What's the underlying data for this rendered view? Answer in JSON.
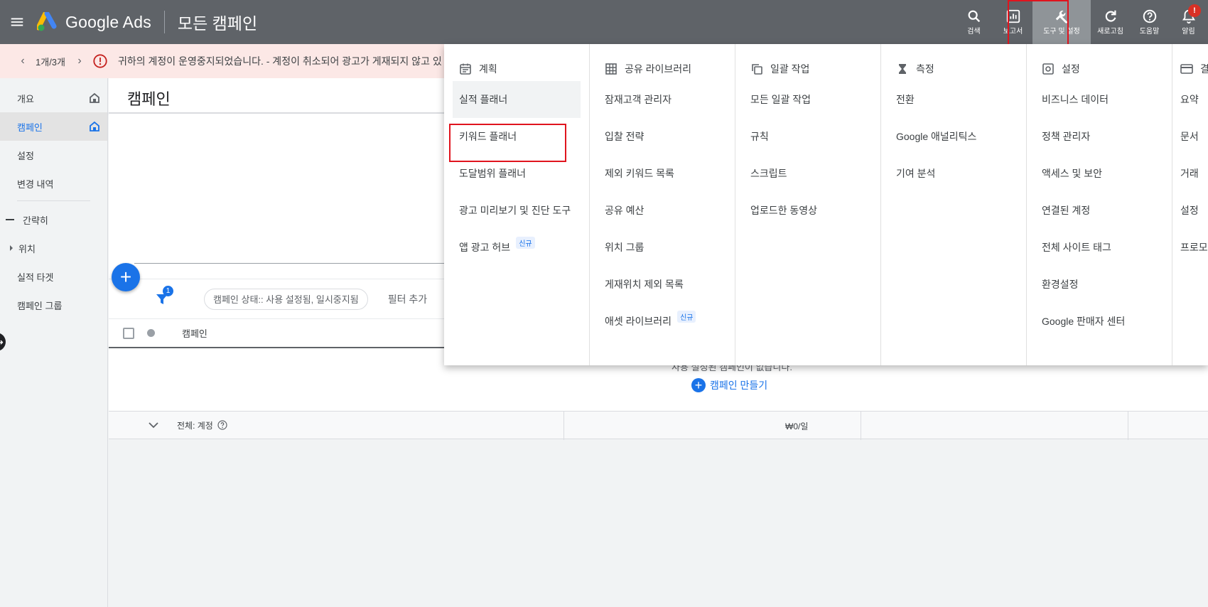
{
  "topbar": {
    "brand": "Google Ads",
    "page_heading": "모든 캠페인",
    "actions": [
      {
        "label": "검색",
        "icon": "search-icon"
      },
      {
        "label": "보고서",
        "icon": "report-icon"
      },
      {
        "label": "도구 및 설정",
        "icon": "wrench-icon"
      },
      {
        "label": "새로고침",
        "icon": "refresh-icon"
      },
      {
        "label": "도움말",
        "icon": "help-icon"
      },
      {
        "label": "알림",
        "icon": "bell-icon"
      }
    ],
    "notification_badge": "!"
  },
  "alert": {
    "pager": "1개/3개",
    "text": "귀하의 계정이 운영중지되었습니다. - 계정이 취소되어 광고가 게재되지 않고 있"
  },
  "sidebar": {
    "items": [
      {
        "label": "개요"
      },
      {
        "label": "캠페인"
      },
      {
        "label": "설정"
      },
      {
        "label": "변경 내역"
      }
    ],
    "group_label": "간략히",
    "sub_items": [
      {
        "label": "위치"
      },
      {
        "label": "실적 타겟"
      },
      {
        "label": "캠페인 그룹"
      }
    ]
  },
  "main": {
    "title": "캠페인",
    "filter_badge": "1",
    "filter_chip": "캠페인 상태:: 사용 설정됨, 일시중지됨",
    "add_filter": "필터 추가",
    "col_campaign": "캠페인",
    "empty_text": "사용 설정된 캠페인이 없습니다.",
    "create_campaign": "캠페인 만들기",
    "total_label": "전체: 계정",
    "budget": "₩0/일"
  },
  "dropdown": {
    "columns": [
      {
        "header": "계획",
        "items": [
          {
            "label": "실적 플래너",
            "badge": ""
          },
          {
            "label": "키워드 플래너",
            "badge": ""
          },
          {
            "label": "도달범위 플래너",
            "badge": ""
          },
          {
            "label": "광고 미리보기 및 진단 도구",
            "badge": ""
          },
          {
            "label": "앱 광고 허브",
            "badge": "신규"
          }
        ]
      },
      {
        "header": "공유 라이브러리",
        "items": [
          {
            "label": "잠재고객 관리자",
            "badge": ""
          },
          {
            "label": "입찰 전략",
            "badge": ""
          },
          {
            "label": "제외 키워드 목록",
            "badge": ""
          },
          {
            "label": "공유 예산",
            "badge": ""
          },
          {
            "label": "위치 그룹",
            "badge": ""
          },
          {
            "label": "게재위치 제외 목록",
            "badge": ""
          },
          {
            "label": "애셋 라이브러리",
            "badge": "신규"
          }
        ]
      },
      {
        "header": "일괄 작업",
        "items": [
          {
            "label": "모든 일괄 작업",
            "badge": ""
          },
          {
            "label": "규칙",
            "badge": ""
          },
          {
            "label": "스크립트",
            "badge": ""
          },
          {
            "label": "업로드한 동영상",
            "badge": ""
          }
        ]
      },
      {
        "header": "측정",
        "items": [
          {
            "label": "전환",
            "badge": ""
          },
          {
            "label": "Google 애널리틱스",
            "badge": ""
          },
          {
            "label": "기여 분석",
            "badge": ""
          }
        ]
      },
      {
        "header": "설정",
        "items": [
          {
            "label": "비즈니스 데이터",
            "badge": ""
          },
          {
            "label": "정책 관리자",
            "badge": ""
          },
          {
            "label": "액세스 및 보안",
            "badge": ""
          },
          {
            "label": "연결된 계정",
            "badge": ""
          },
          {
            "label": "전체 사이트 태그",
            "badge": ""
          },
          {
            "label": "환경설정",
            "badge": ""
          },
          {
            "label": "Google 판매자 센터",
            "badge": ""
          }
        ]
      },
      {
        "header": "결",
        "items": [
          {
            "label": "요약",
            "badge": ""
          },
          {
            "label": "문서",
            "badge": ""
          },
          {
            "label": "거래",
            "badge": ""
          },
          {
            "label": "설정",
            "badge": ""
          },
          {
            "label": "프로모",
            "badge": ""
          }
        ]
      }
    ]
  },
  "colors": {
    "topbar": "#5f6368",
    "accent": "#1a73e8",
    "alert_bg": "#fce8e6",
    "alert_icon": "#c5221f",
    "highlight_outline": "#e0141e"
  }
}
